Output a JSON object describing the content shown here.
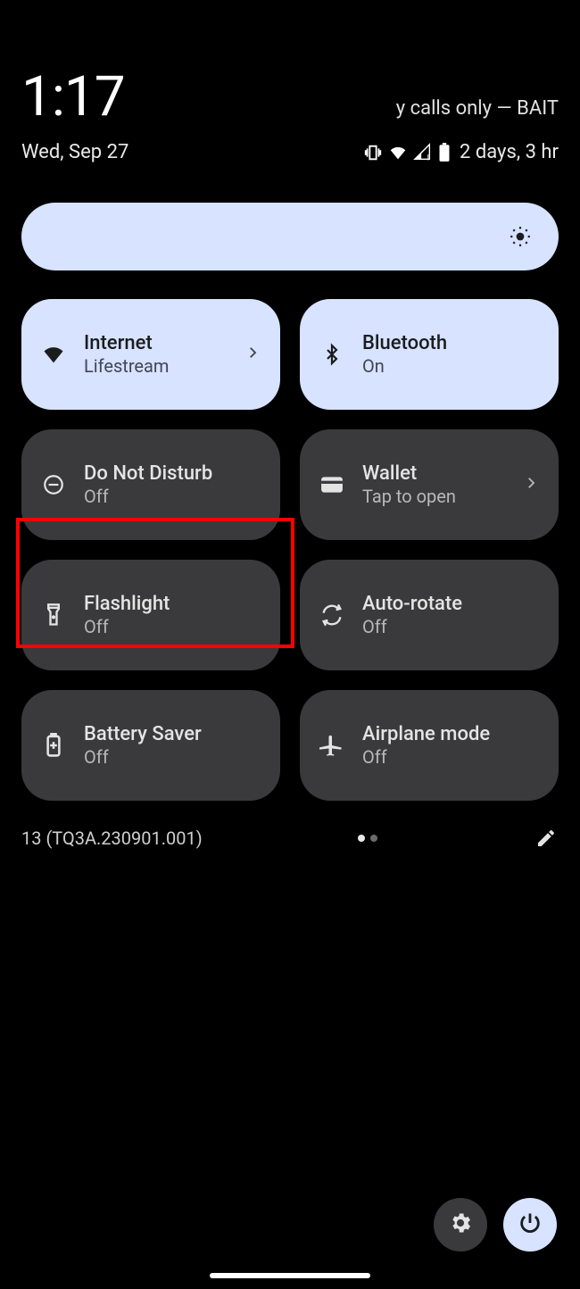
{
  "header": {
    "time": "1:17",
    "carrier": "y calls only — BAIT",
    "date": "Wed, Sep 27",
    "battery_text": "2 days, 3 hr"
  },
  "tiles": {
    "internet": {
      "title": "Internet",
      "sub": "Lifestream"
    },
    "bluetooth": {
      "title": "Bluetooth",
      "sub": "On"
    },
    "dnd": {
      "title": "Do Not Disturb",
      "sub": "Off"
    },
    "wallet": {
      "title": "Wallet",
      "sub": "Tap to open"
    },
    "flashlight": {
      "title": "Flashlight",
      "sub": "Off"
    },
    "autorotate": {
      "title": "Auto-rotate",
      "sub": "Off"
    },
    "battery": {
      "title": "Battery Saver",
      "sub": "Off"
    },
    "airplane": {
      "title": "Airplane mode",
      "sub": "Off"
    }
  },
  "footer": {
    "build": "13 (TQ3A.230901.001)"
  }
}
